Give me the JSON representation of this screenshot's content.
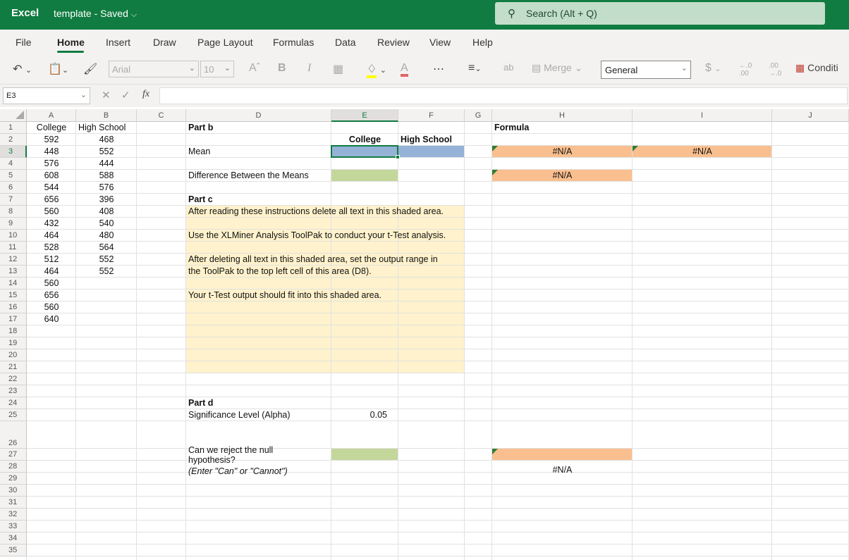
{
  "app": {
    "name": "Excel",
    "doc_title": "template",
    "save_state": "Saved",
    "doc_chevron": "⌵"
  },
  "search": {
    "placeholder": "Search (Alt + Q)"
  },
  "menu": [
    "File",
    "Home",
    "Insert",
    "Draw",
    "Page Layout",
    "Formulas",
    "Data",
    "Review",
    "View",
    "Help"
  ],
  "ribbon": {
    "font": "Arial",
    "size": "10",
    "merge": "Merge",
    "number_format": "General",
    "conditional": "Conditi"
  },
  "namebox": "E3",
  "col_headers": [
    "A",
    "B",
    "C",
    "D",
    "E",
    "F",
    "G",
    "H",
    "I",
    "J"
  ],
  "row_headers": [
    "1",
    "2",
    "3",
    "4",
    "5",
    "6",
    "7",
    "8",
    "9",
    "10",
    "11",
    "12",
    "13",
    "14",
    "15",
    "16",
    "17",
    "18",
    "19",
    "20",
    "21",
    "22",
    "23",
    "24",
    "25",
    "26",
    "27",
    "28",
    "29",
    "30",
    "31",
    "32",
    "33",
    "34",
    "35"
  ],
  "cells": {
    "A1": "College",
    "B1": "High School",
    "A2": "592",
    "B2": "468",
    "A3": "448",
    "B3": "552",
    "A4": "576",
    "B4": "444",
    "A5": "608",
    "B5": "588",
    "A6": "544",
    "B6": "576",
    "A7": "656",
    "B7": "396",
    "A8": "560",
    "B8": "408",
    "A9": "432",
    "B9": "540",
    "A10": "464",
    "B10": "480",
    "A11": "528",
    "B11": "564",
    "A12": "512",
    "B12": "552",
    "A13": "464",
    "B13": "552",
    "A14": "560",
    "A15": "656",
    "A16": "560",
    "A17": "640",
    "D1": "Part b",
    "H1": "Formula",
    "E2": "College",
    "F2": "High School",
    "D3": "Mean",
    "H3": "#N/A",
    "I3": "#N/A",
    "D5": "Difference Between the Means",
    "H5": "#N/A",
    "D7": "Part c",
    "D8": "After reading these instructions delete all text in this shaded area.",
    "D10": "Use the XLMiner Analysis ToolPak to conduct your t-Test analysis.",
    "D12": "After deleting all text in this shaded area, set the output range in",
    "D13": "the ToolPak to the top left cell of this area (D8).",
    "D15": "Your t-Test output should fit into this shaded area.",
    "D24": "Part d",
    "D25": "Significance Level (Alpha)",
    "E25": "0.05",
    "D27a": "Can we reject the null",
    "D27b": "hypothesis?",
    "D27c": "(Enter \"Can\" or \"Cannot\")",
    "H27": "#N/A"
  },
  "colors": {
    "brand": "#107c41",
    "blue_fill": "#95b3d7",
    "green_fill": "#c4d79b",
    "orange_fill": "#fabf8f",
    "yellow_fill": "#fff2cc"
  }
}
